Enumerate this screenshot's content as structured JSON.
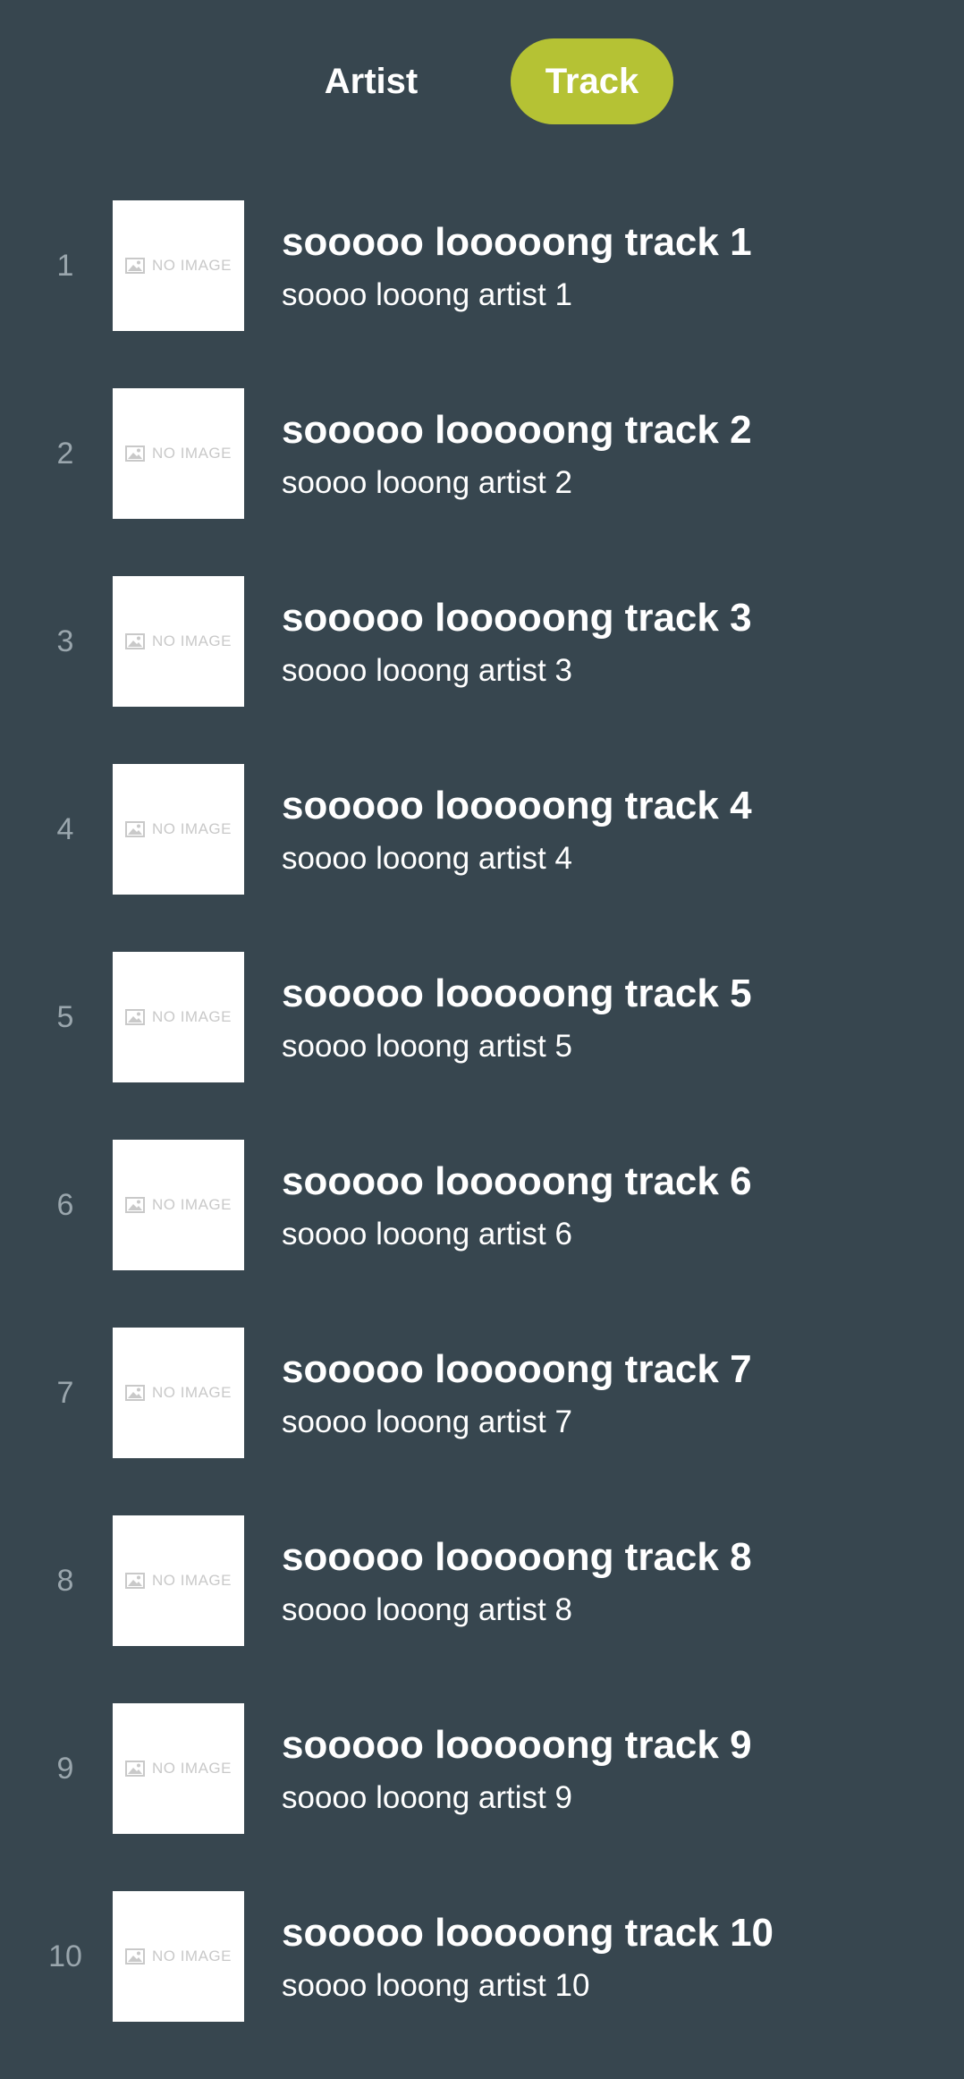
{
  "tabs": {
    "artist_label": "Artist",
    "track_label": "Track",
    "active": "Track"
  },
  "placeholder_text": "NO IMAGE",
  "colors": {
    "background": "#37464f",
    "active_tab": "#b5c234",
    "rank_text": "#9aa6ad"
  },
  "tracks": [
    {
      "rank": "1",
      "title": "sooooo looooong track 1",
      "artist": "soooo looong artist 1"
    },
    {
      "rank": "2",
      "title": "sooooo looooong track 2",
      "artist": "soooo looong artist 2"
    },
    {
      "rank": "3",
      "title": "sooooo looooong track 3",
      "artist": "soooo looong artist 3"
    },
    {
      "rank": "4",
      "title": "sooooo looooong track 4",
      "artist": "soooo looong artist 4"
    },
    {
      "rank": "5",
      "title": "sooooo looooong track 5",
      "artist": "soooo looong artist 5"
    },
    {
      "rank": "6",
      "title": "sooooo looooong track 6",
      "artist": "soooo looong artist 6"
    },
    {
      "rank": "7",
      "title": "sooooo looooong track 7",
      "artist": "soooo looong artist 7"
    },
    {
      "rank": "8",
      "title": "sooooo looooong track 8",
      "artist": "soooo looong artist 8"
    },
    {
      "rank": "9",
      "title": "sooooo looooong track 9",
      "artist": "soooo looong artist 9"
    },
    {
      "rank": "10",
      "title": "sooooo looooong track 10",
      "artist": "soooo looong artist 10"
    }
  ]
}
